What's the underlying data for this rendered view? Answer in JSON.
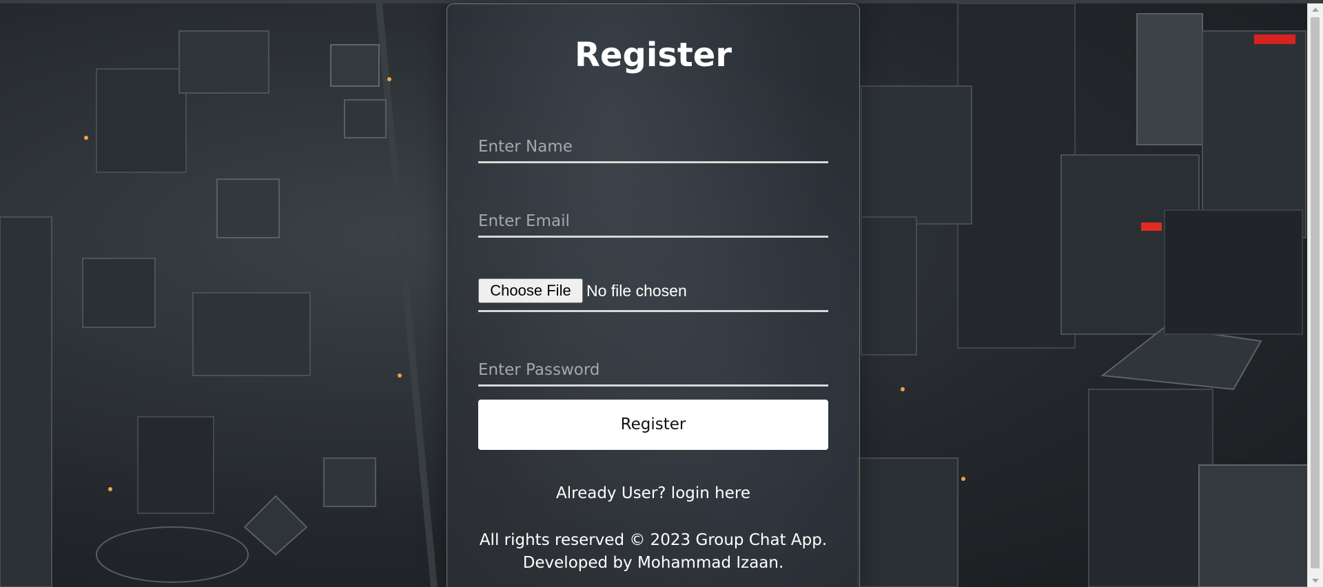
{
  "form": {
    "title": "Register",
    "name_placeholder": "Enter Name",
    "email_placeholder": "Enter Email",
    "file_button_label": "Choose File",
    "file_status": "No file chosen",
    "password_placeholder": "Enter Password",
    "submit_label": "Register",
    "login_prompt": "Already User? login here"
  },
  "footer": {
    "line1": "All rights reserved © 2023 Group Chat App.",
    "line2": "Developed by Mohammad Izaan."
  }
}
